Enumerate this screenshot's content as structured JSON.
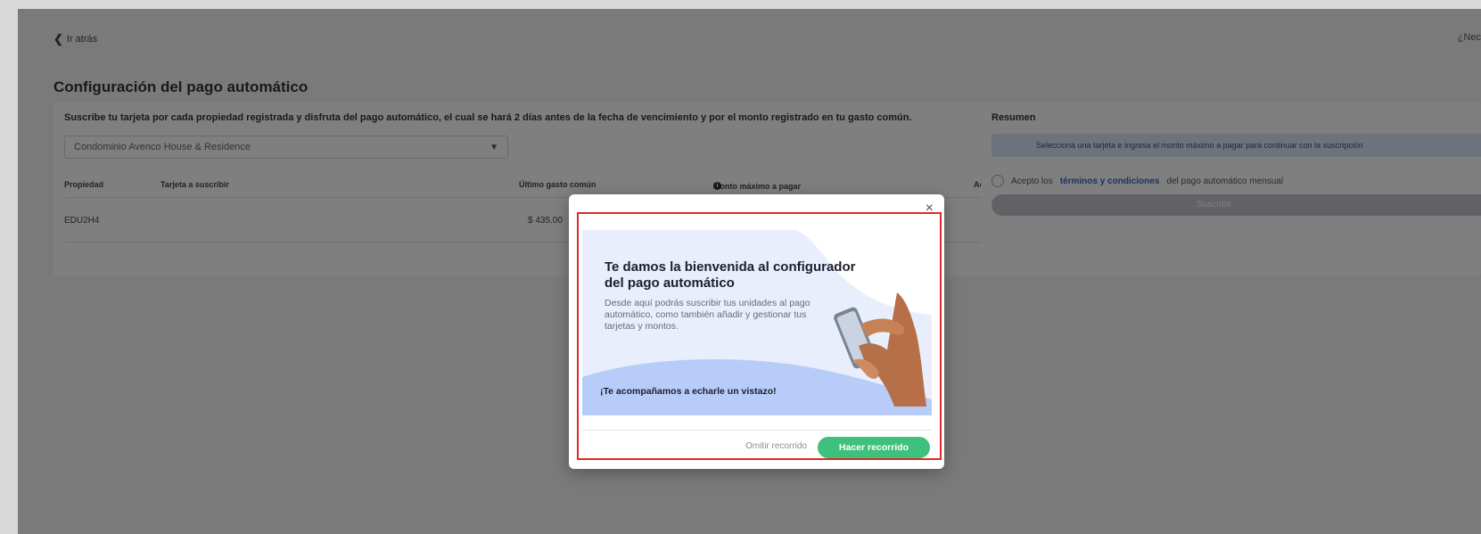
{
  "header": {
    "back_label": "Ir atrás",
    "top_right_text": "¿Nec"
  },
  "page": {
    "title": "Configuración del pago automático"
  },
  "main": {
    "intro": "Suscribe tu tarjeta por cada propiedad registrada y disfruta del pago automático, el cual se hará 2 días antes de la fecha de vencimiento y por el monto registrado en tu gasto común.",
    "property_select": "Condominio Avenco House & Residence",
    "table": {
      "headers": [
        "Propiedad",
        "Tarjeta a suscribir",
        "Último gasto común",
        "Monto máximo a pagar",
        "Acciones"
      ],
      "rows": [
        [
          "EDU2H4",
          "",
          "$ 435.00",
          "",
          ""
        ]
      ]
    }
  },
  "summary": {
    "title": "Resumen",
    "notice": "Selecciona una tarjeta e ingresa el monto máximo a pagar para continuar con la suscripción",
    "terms_prefix": "Acepto los",
    "terms_link": "términos y condiciones",
    "terms_suffix": "del pago automático mensual",
    "subscribe_label": "Suscribir"
  },
  "modal": {
    "close_label": "×",
    "title": "Te damos la bienvenida al configurador del pago automático",
    "description": "Desde aquí podrás suscribir tus unidades al pago automático, como también añadir y gestionar tus tarjetas y montos.",
    "footer_text": "¡Te acompañamos a echarle un vistazo!",
    "skip_label": "Omitir recorrido",
    "tour_label": "Hacer recorrido"
  },
  "colors": {
    "highlight_border": "#e02828",
    "primary_green": "#3ec17c",
    "hero_blue": "#b7ccf8",
    "hero_light": "#e8eefb"
  }
}
